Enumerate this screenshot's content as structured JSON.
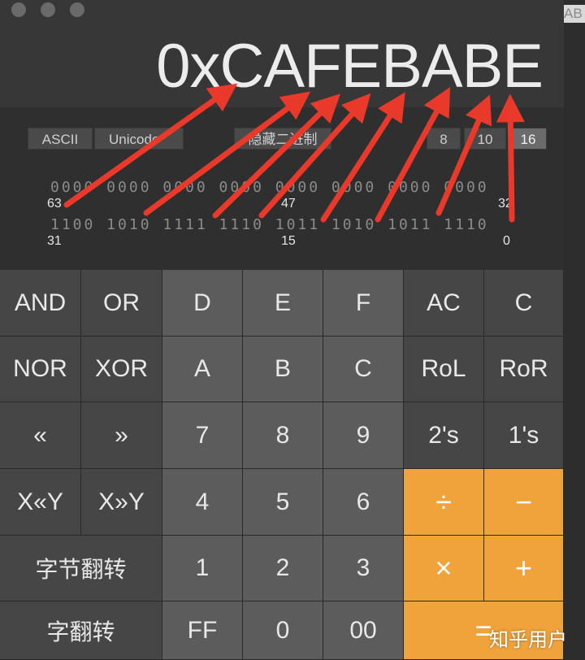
{
  "background_strip_text": "AB",
  "display": {
    "value": "0xCAFEBABE"
  },
  "encoding_tabs": [
    {
      "label": "ASCII"
    },
    {
      "label": "Unicode"
    },
    {
      "label": "隐藏二进制"
    }
  ],
  "base_tabs": [
    {
      "label": "8"
    },
    {
      "label": "10"
    },
    {
      "label": "16",
      "active": true
    }
  ],
  "bits": {
    "row1": "0000 0000 0000 0000 0000 0000 0000 0000",
    "row1_labels": [
      "63",
      "47",
      "32"
    ],
    "row2": "1100 1010 1111 1110 1011 1010 1011 1110",
    "row2_labels": [
      "31",
      "15",
      "0"
    ]
  },
  "keys": [
    [
      {
        "label": "AND"
      },
      {
        "label": "OR"
      },
      {
        "label": "D"
      },
      {
        "label": "E"
      },
      {
        "label": "F"
      },
      {
        "label": "AC"
      },
      {
        "label": "C"
      }
    ],
    [
      {
        "label": "NOR"
      },
      {
        "label": "XOR"
      },
      {
        "label": "A"
      },
      {
        "label": "B"
      },
      {
        "label": "C"
      },
      {
        "label": "RoL"
      },
      {
        "label": "RoR"
      }
    ],
    [
      {
        "label": "«"
      },
      {
        "label": "»"
      },
      {
        "label": "7"
      },
      {
        "label": "8"
      },
      {
        "label": "9"
      },
      {
        "label": "2's"
      },
      {
        "label": "1's"
      }
    ],
    [
      {
        "label": "X«Y"
      },
      {
        "label": "X»Y"
      },
      {
        "label": "4"
      },
      {
        "label": "5"
      },
      {
        "label": "6"
      },
      {
        "label": "÷"
      },
      {
        "label": "−"
      }
    ],
    [
      {
        "label": "字节翻转"
      },
      {
        "label": "1"
      },
      {
        "label": "2"
      },
      {
        "label": "3"
      },
      {
        "label": "×"
      },
      {
        "label": "+"
      }
    ],
    [
      {
        "label": "字翻转"
      },
      {
        "label": "FF"
      },
      {
        "label": "0"
      },
      {
        "label": "00"
      },
      {
        "label": "="
      }
    ]
  ],
  "colors": {
    "orange": "#f0a23b",
    "annotation_arrow": "#e8392a"
  },
  "watermark": "知乎用户"
}
